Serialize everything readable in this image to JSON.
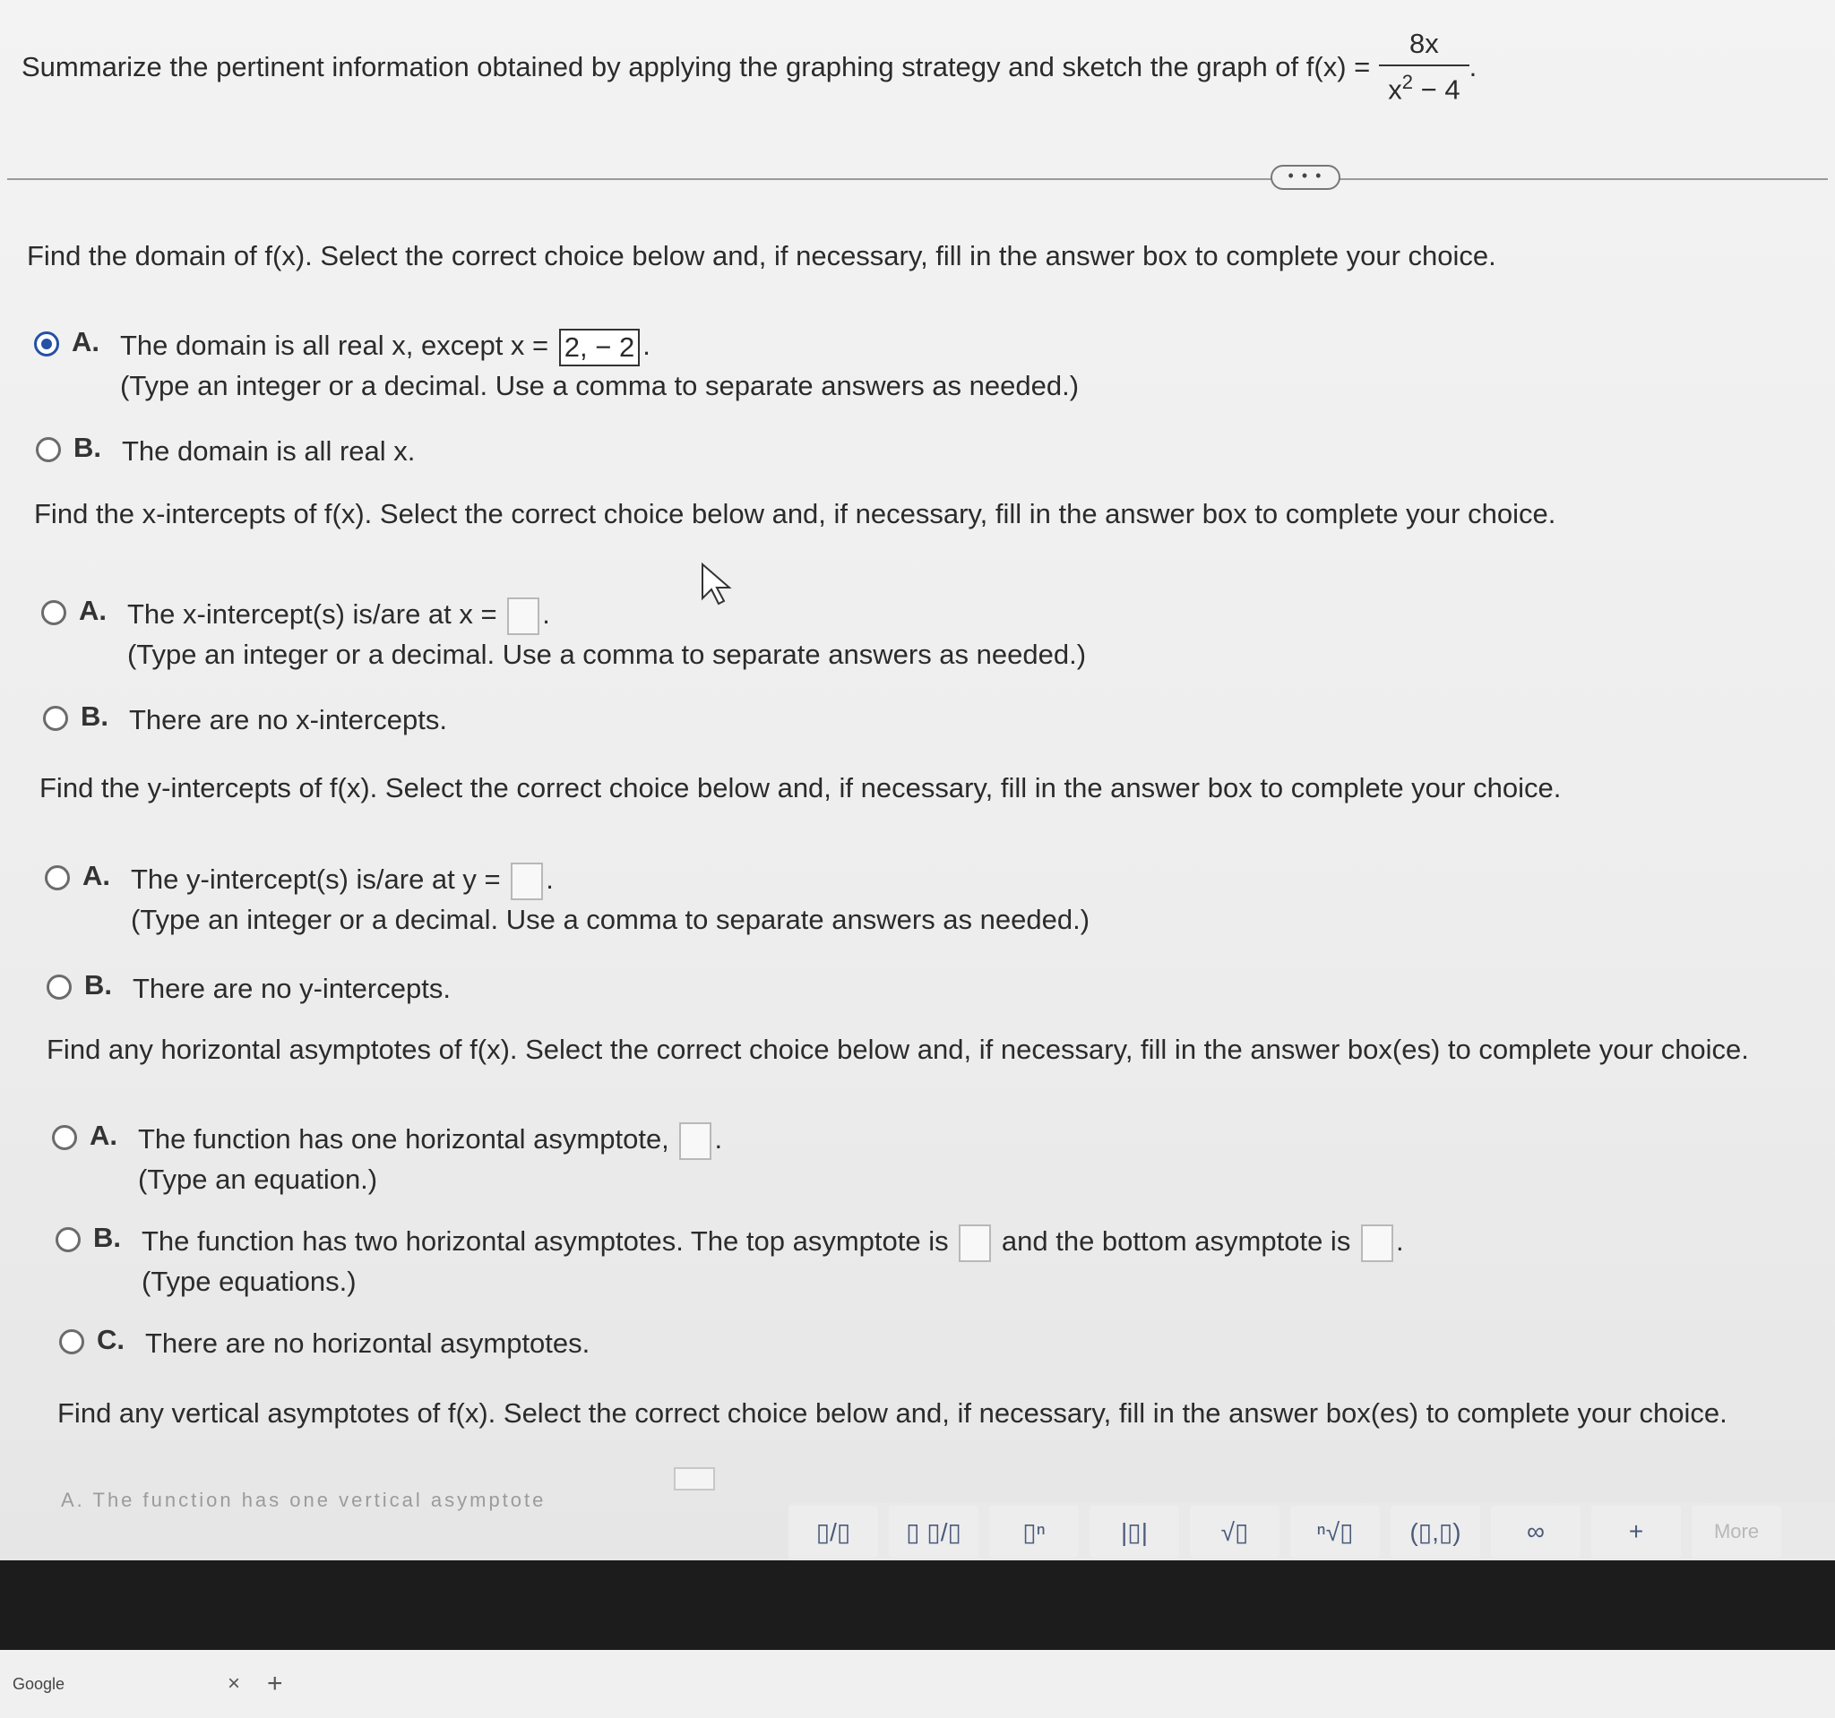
{
  "header": {
    "prompt": "Summarize the pertinent information obtained by applying the graphing strategy and sketch the graph of f(x) =",
    "numerator": "8x",
    "denominator_base": "x",
    "denominator_exp": "2",
    "denominator_rest": " − 4",
    "end": "."
  },
  "more_label": "• • •",
  "domain": {
    "question": "Find the domain of f(x). Select the correct choice below and, if necessary, fill in the answer box to complete your choice.",
    "a_letter": "A.",
    "a_text": "The domain is all real x, except x =",
    "a_value": "2, − 2",
    "a_end": ".",
    "a_hint": "(Type an integer or a decimal. Use a comma to separate answers as needed.)",
    "b_letter": "B.",
    "b_text": "The domain is all real x."
  },
  "xint": {
    "question": "Find the x-intercepts of f(x). Select the correct choice below and, if necessary, fill in the answer box to complete your choice.",
    "a_letter": "A.",
    "a_text": "The x-intercept(s) is/are at x =",
    "a_end": ".",
    "a_hint": "(Type an integer or a decimal. Use a comma to separate answers as needed.)",
    "b_letter": "B.",
    "b_text": "There are no x-intercepts."
  },
  "yint": {
    "question": "Find the y-intercepts of f(x). Select the correct choice below and, if necessary, fill in the answer box to complete your choice.",
    "a_letter": "A.",
    "a_text": "The y-intercept(s) is/are at y =",
    "a_end": ".",
    "a_hint": "(Type an integer or a decimal. Use a comma to separate answers as needed.)",
    "b_letter": "B.",
    "b_text": "There are no y-intercepts."
  },
  "hasym": {
    "question": "Find any horizontal asymptotes of f(x). Select the correct choice below and, if necessary, fill in the answer box(es) to complete your choice.",
    "a_letter": "A.",
    "a_text": "The function has one horizontal asymptote,",
    "a_end": ".",
    "a_hint": "(Type an equation.)",
    "b_letter": "B.",
    "b_text1": "The function has two horizontal asymptotes. The top asymptote is",
    "b_text2": "and the bottom asymptote is",
    "b_end": ".",
    "b_hint": "(Type equations.)",
    "c_letter": "C.",
    "c_text": "There are no horizontal asymptotes."
  },
  "vasym": {
    "question": "Find any vertical asymptotes of f(x). Select the correct choice below and, if necessary, fill in the answer box(es) to complete your choice.",
    "cut_text": "A.   The function has one vertical asymptote"
  },
  "toolbar": [
    "▯/▯",
    "▯ ▯/▯",
    "▯ⁿ",
    "|▯|",
    "√▯",
    "ⁿ√▯",
    "(▯,▯)",
    "∞",
    "+",
    "More"
  ],
  "tabbar": {
    "tab_title": "Google",
    "close": "×",
    "new_tab": "+"
  }
}
